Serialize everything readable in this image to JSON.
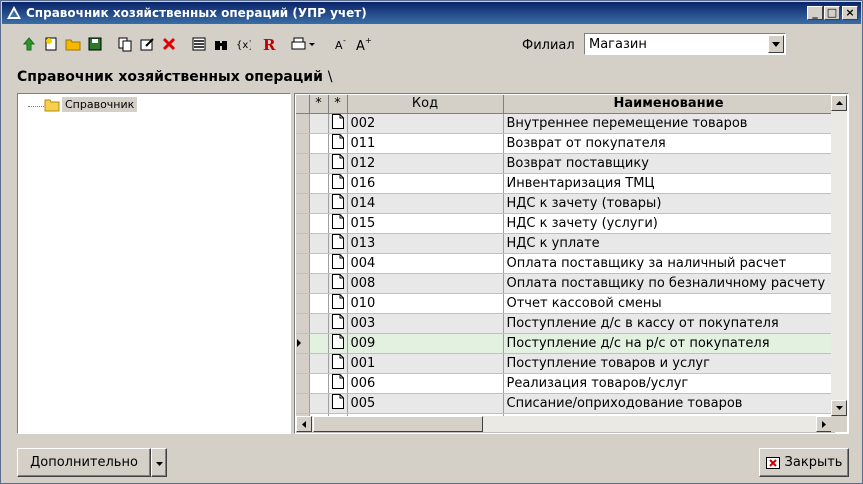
{
  "window": {
    "title": "Справочник хозяйственных операций (УПР учет)",
    "controls": [
      "minimize-icon",
      "maximize-icon",
      "close-icon"
    ]
  },
  "toolbar": {
    "buttons": [
      "up-arrow-icon",
      "new-record-icon",
      "folder-icon",
      "save-icon",
      "copy-icon",
      "edit-icon",
      "delete-icon",
      "list-icon",
      "binoculars-icon",
      "variables-icon",
      "report-icon",
      "print-icon",
      "font-decrease-icon",
      "font-increase-icon"
    ]
  },
  "filial": {
    "label": "Филиал",
    "value": "Магазин"
  },
  "section_title": "Справочник хозяйственных операций",
  "section_sep": "\\",
  "tree": {
    "root_label": "Справочник"
  },
  "grid": {
    "columns": [
      "*",
      "*",
      "Код",
      "Наименование"
    ],
    "rows": [
      {
        "code": "002",
        "name": "Внутреннее перемещение товаров"
      },
      {
        "code": "011",
        "name": "Возврат от покупателя"
      },
      {
        "code": "012",
        "name": "Возврат поставщику"
      },
      {
        "code": "016",
        "name": "Инвентаризация ТМЦ"
      },
      {
        "code": "014",
        "name": "НДС к зачету (товары)"
      },
      {
        "code": "015",
        "name": "НДС к зачету (услуги)"
      },
      {
        "code": "013",
        "name": "НДС к уплате"
      },
      {
        "code": "004",
        "name": "Оплата поставщику за наличный расчет"
      },
      {
        "code": "008",
        "name": "Оплата поставщику по безналичному расчету"
      },
      {
        "code": "010",
        "name": "Отчет кассовой смены"
      },
      {
        "code": "003",
        "name": "Поступление д/с в кассу от покупателя"
      },
      {
        "code": "009",
        "name": "Поступление д/с на р/с от покупателя"
      },
      {
        "code": "001",
        "name": "Поступление товаров и услуг"
      },
      {
        "code": "006",
        "name": "Реализация товаров/услуг"
      },
      {
        "code": "005",
        "name": "Списание/оприходование  товаров"
      }
    ],
    "selected_index": 11
  },
  "footer": {
    "more_label": "Дополнительно",
    "close_label": "Закрыть"
  }
}
